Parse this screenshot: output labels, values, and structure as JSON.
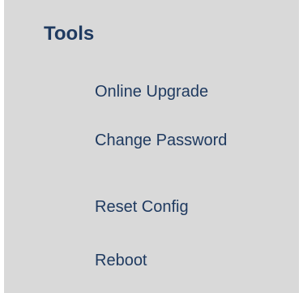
{
  "menu": {
    "title": "Tools",
    "items": [
      {
        "label": "Online Upgrade"
      },
      {
        "label": "Change Password"
      },
      {
        "label": "Reset Config"
      },
      {
        "label": "Reboot"
      }
    ]
  },
  "colors": {
    "panel_background": "#d9d9d9",
    "text": "#1f3a60"
  }
}
